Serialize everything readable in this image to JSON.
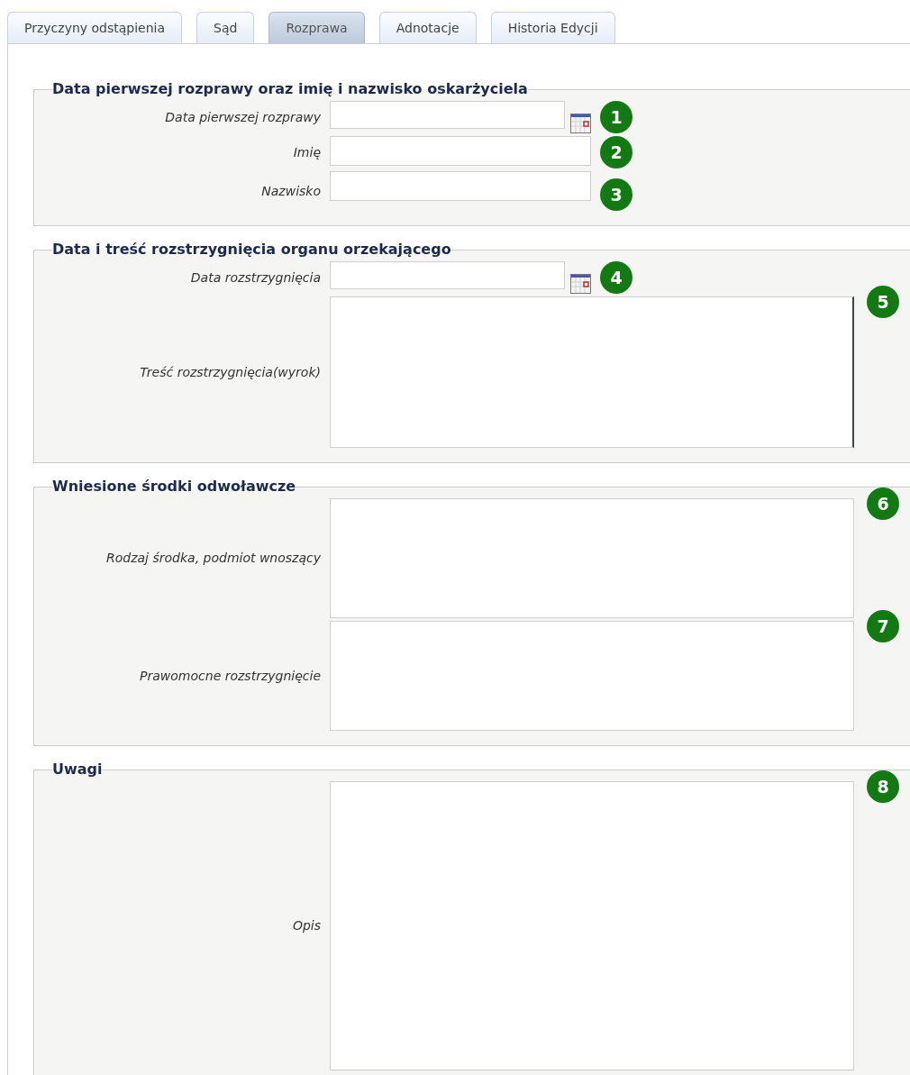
{
  "tabs": [
    {
      "label": "Przyczyny odstąpienia",
      "selected": false
    },
    {
      "label": "Sąd",
      "selected": false
    },
    {
      "label": "Rozprawa",
      "selected": true
    },
    {
      "label": "Adnotacje",
      "selected": false
    },
    {
      "label": "Historia Edycji",
      "selected": false
    }
  ],
  "sections": [
    {
      "legend": "Data pierwszej rozprawy oraz imię i nazwisko oskarżyciela",
      "fields": [
        {
          "label": "Data pierwszej rozprawy",
          "kind": "date",
          "badge": "1"
        },
        {
          "label": "Imię",
          "kind": "text",
          "badge": "2"
        },
        {
          "label": "Nazwisko",
          "kind": "text",
          "badge": "3"
        }
      ]
    },
    {
      "legend": "Data i treść rozstrzygnięcia organu orzekającego",
      "fields": [
        {
          "label": "Data rozstrzygnięcia",
          "kind": "date",
          "badge": "4"
        },
        {
          "label": "Treść rozstrzygnięcia(wyrok)",
          "kind": "textarea",
          "badge": "5"
        }
      ]
    },
    {
      "legend": "Wniesione środki odwoławcze",
      "fields": [
        {
          "label": "Rodzaj środka, podmiot wnoszący",
          "kind": "textarea",
          "badge": "6"
        },
        {
          "label": "Prawomocne rozstrzygnięcie",
          "kind": "textarea",
          "badge": "7"
        }
      ]
    },
    {
      "legend": "Uwagi",
      "fields": [
        {
          "label": "Opis",
          "kind": "textarea",
          "badge": "8"
        }
      ]
    }
  ]
}
